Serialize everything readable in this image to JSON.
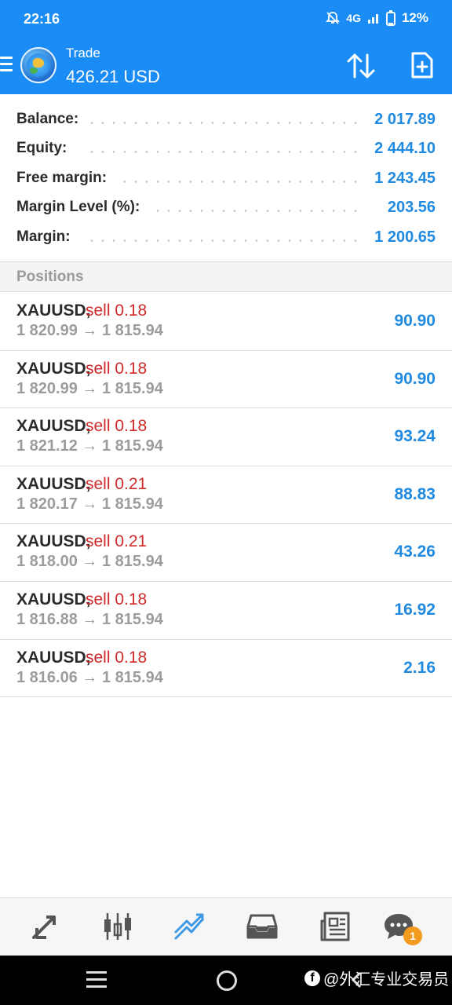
{
  "status_bar": {
    "time": "22:16",
    "network": "4G",
    "battery": "12%"
  },
  "header": {
    "title": "Trade",
    "balance": "426.21 USD"
  },
  "summary": [
    {
      "label": "Balance:",
      "value": "2 017.89"
    },
    {
      "label": "Equity:",
      "value": "2 444.10"
    },
    {
      "label": "Free margin:",
      "value": "1 243.45"
    },
    {
      "label": "Margin Level (%):",
      "value": "203.56"
    },
    {
      "label": "Margin:",
      "value": "1 200.65"
    }
  ],
  "positions_header": "Positions",
  "positions": [
    {
      "symbol": "XAUUSD,",
      "side": "sell 0.18",
      "prices": "1 820.99 → 1 815.94",
      "profit": "90.90"
    },
    {
      "symbol": "XAUUSD,",
      "side": "sell 0.18",
      "prices": "1 820.99 → 1 815.94",
      "profit": "90.90"
    },
    {
      "symbol": "XAUUSD,",
      "side": "sell 0.18",
      "prices": "1 821.12 → 1 815.94",
      "profit": "93.24"
    },
    {
      "symbol": "XAUUSD,",
      "side": "sell 0.21",
      "prices": "1 820.17 → 1 815.94",
      "profit": "88.83"
    },
    {
      "symbol": "XAUUSD,",
      "side": "sell 0.21",
      "prices": "1 818.00 → 1 815.94",
      "profit": "43.26"
    },
    {
      "symbol": "XAUUSD,",
      "side": "sell 0.18",
      "prices": "1 816.88 → 1 815.94",
      "profit": "16.92"
    },
    {
      "symbol": "XAUUSD,",
      "side": "sell 0.18",
      "prices": "1 816.06 → 1 815.94",
      "profit": "2.16"
    }
  ],
  "bottom_nav": {
    "items": [
      "quotes-icon",
      "chart-icon",
      "trade-icon",
      "history-icon",
      "news-icon",
      "chat-icon"
    ],
    "active": "trade-icon",
    "chat_badge": "1"
  },
  "watermark": "@外汇专业交易员",
  "colors": {
    "accent": "#1a8cf5",
    "sell": "#d12a2a",
    "profit": "#1f8ae0",
    "badge": "#f29b1c"
  }
}
